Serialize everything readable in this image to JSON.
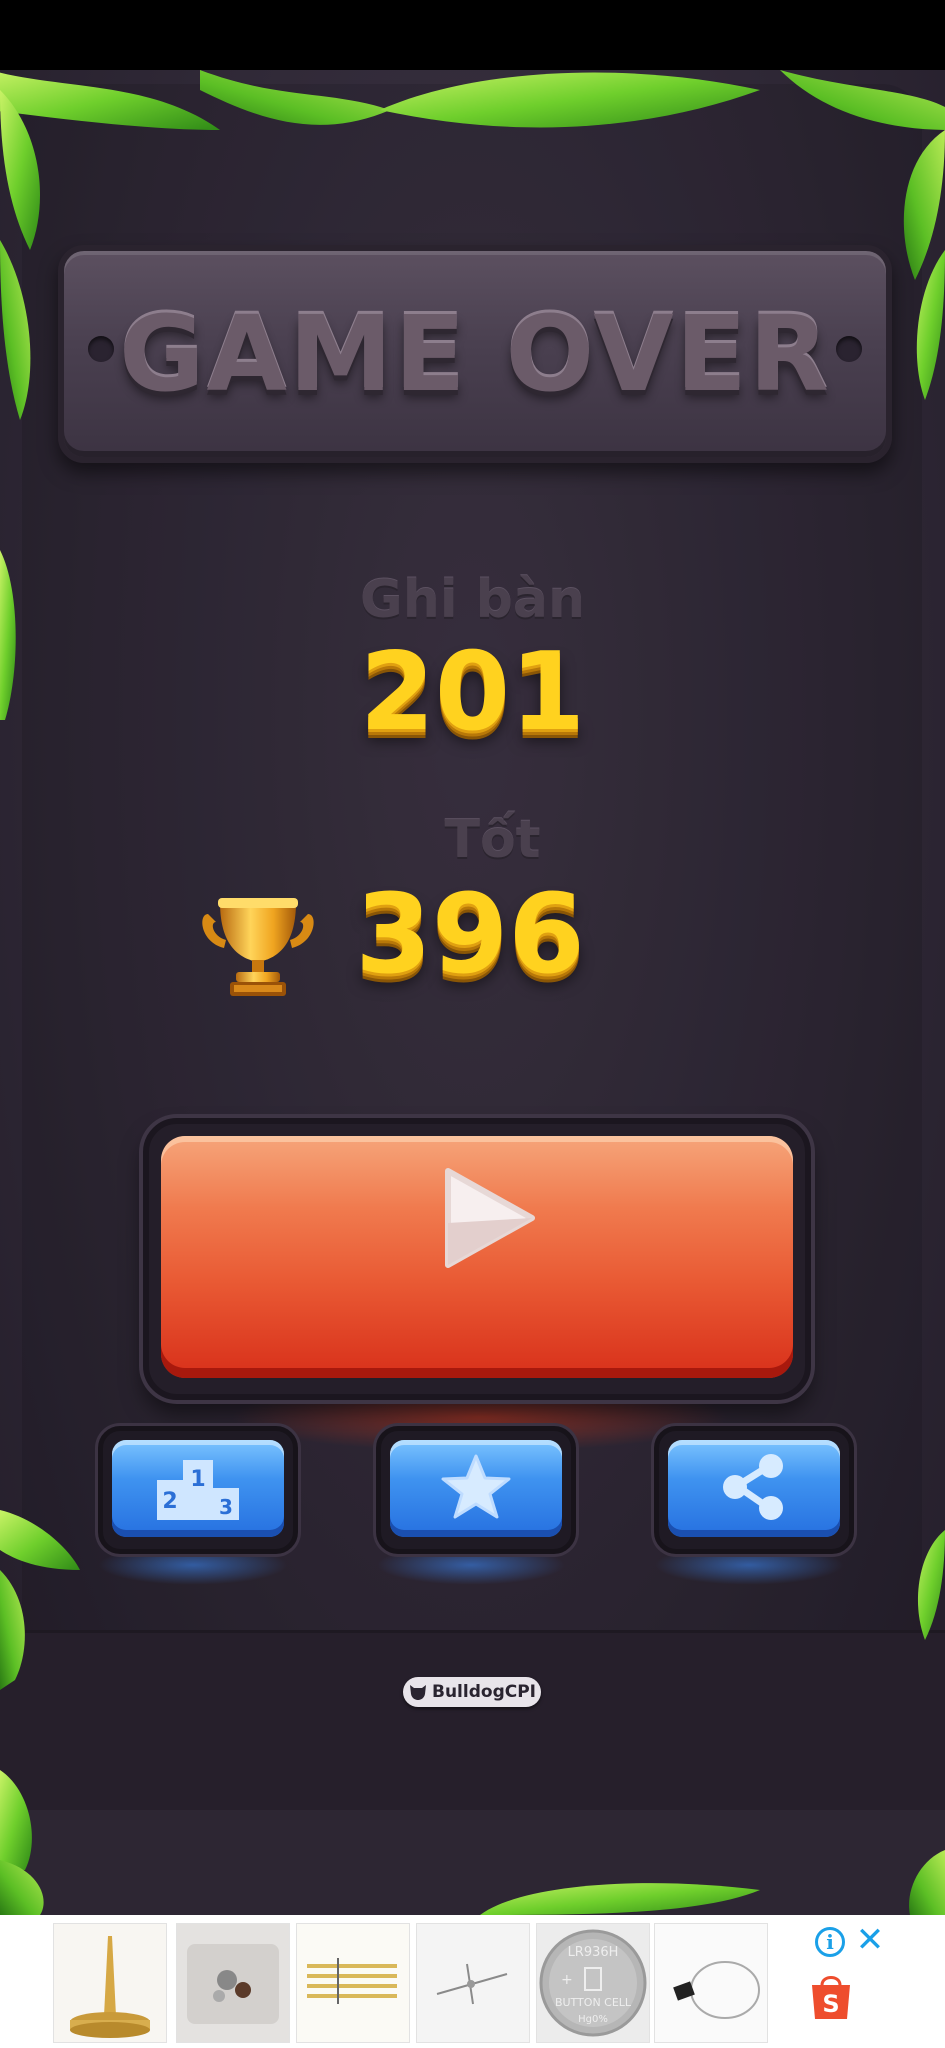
{
  "header": {
    "title": "GAME OVER"
  },
  "score": {
    "label": "Ghi bàn",
    "value": "201"
  },
  "best": {
    "label": "Tốt",
    "value": "396"
  },
  "buttons": {
    "play": "play-icon",
    "leaderboard": "podium-icon",
    "rate": "star-icon",
    "share": "share-icon"
  },
  "podium": {
    "first": "1",
    "second": "2",
    "third": "3"
  },
  "brand": {
    "label": "BulldogCPI"
  },
  "ad": {
    "info_label": "i",
    "close_label": "✕",
    "shop_logo_letter": "S",
    "battery": {
      "model": "LR936H",
      "type": "BUTTON CELL",
      "code": "Hg0%"
    }
  },
  "colors": {
    "gold": "#ffd21f",
    "play_red": "#e95a34",
    "button_blue": "#3f93f0",
    "background": "#2f2836",
    "ad_accent": "#1aa0e8",
    "shopee_orange": "#ee4d2d"
  }
}
